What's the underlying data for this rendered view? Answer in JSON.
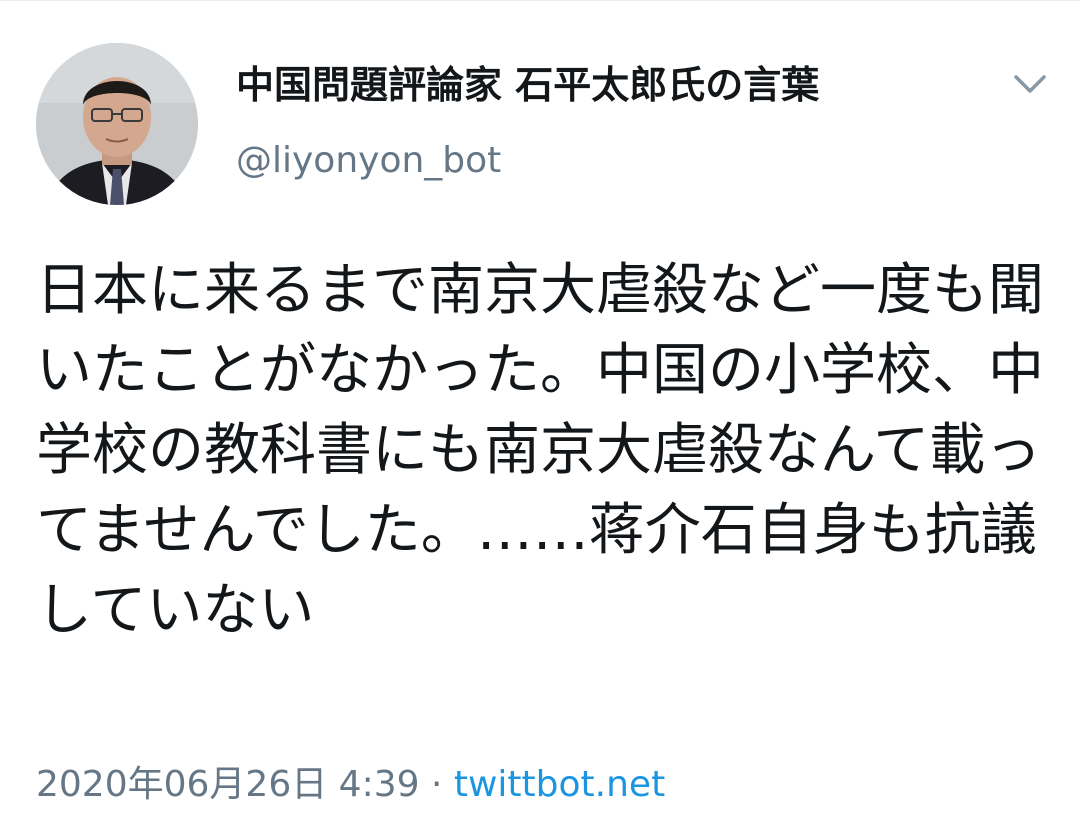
{
  "tweet": {
    "display_name": "中国問題評論家 石平太郎氏の言葉",
    "handle": "@liyonyon_bot",
    "text": "日本に来るまで南京大虐殺など一度も聞いたことがなかった。中国の小学校、中学校の教科書にも南京大虐殺なんて載ってませんでした。……蒋介石自身も抗議していない",
    "timestamp": "2020年06月26日 4:39",
    "separator": " · ",
    "source": "twittbot.net"
  },
  "icons": {
    "menu": "chevron-down-icon",
    "avatar": "user-avatar"
  },
  "colors": {
    "text": "#14171a",
    "secondary": "#657786",
    "link": "#1b95e0",
    "background": "#ffffff"
  }
}
